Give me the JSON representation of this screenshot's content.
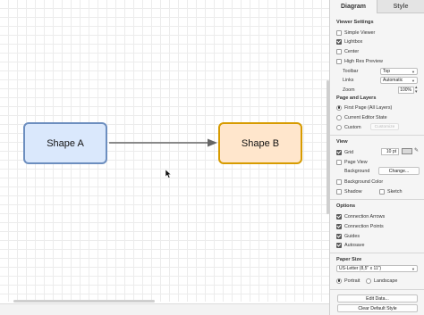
{
  "canvas": {
    "shape_a": {
      "label": "Shape A",
      "fill": "#dae8fc",
      "stroke": "#6c8ebf"
    },
    "shape_b": {
      "label": "Shape B",
      "fill": "#ffe6cc",
      "stroke": "#d79b00"
    },
    "connector_color": "#666666"
  },
  "panel": {
    "tabs": [
      {
        "label": "Diagram",
        "active": true
      },
      {
        "label": "Style",
        "active": false
      }
    ],
    "viewer_settings": {
      "title": "Viewer Settings",
      "simple_viewer": {
        "label": "Simple Viewer",
        "checked": false
      },
      "lightbox": {
        "label": "Lightbox",
        "checked": true
      },
      "center": {
        "label": "Center",
        "checked": false
      },
      "high_res_preview": {
        "label": "High Res Preview",
        "checked": false
      },
      "toolbar": {
        "label": "Toolbar",
        "value": "Top"
      },
      "links": {
        "label": "Links",
        "value": "Automatic"
      },
      "zoom": {
        "label": "Zoom",
        "value": "100%"
      }
    },
    "page_layers": {
      "title": "Page and Layers",
      "first_page": "First Page (All Layers)",
      "current_editor_state": "Current Editor State",
      "custom": "Custom",
      "customize": "Customize",
      "selected": "first_page"
    },
    "view": {
      "title": "View",
      "grid": {
        "label": "Grid",
        "checked": true,
        "size": "10 pt"
      },
      "page_view": {
        "label": "Page View",
        "checked": false
      },
      "background": {
        "label": "Background",
        "button": "Change..."
      },
      "background_color": {
        "label": "Background Color",
        "checked": false
      },
      "shadow": {
        "label": "Shadow",
        "checked": false
      },
      "sketch": {
        "label": "Sketch",
        "checked": false
      }
    },
    "options": {
      "title": "Options",
      "connection_arrows": {
        "label": "Connection Arrows",
        "checked": true
      },
      "connection_points": {
        "label": "Connection Points",
        "checked": true
      },
      "guides": {
        "label": "Guides",
        "checked": true
      },
      "autosave": {
        "label": "Autosave",
        "checked": true
      }
    },
    "paper_size": {
      "title": "Paper Size",
      "value": "US-Letter (8,5\" x 11\")",
      "portrait": "Portrait",
      "landscape": "Landscape",
      "orientation": "portrait"
    },
    "edit_data": "Edit Data...",
    "clear_default_style": "Clear Default Style"
  }
}
